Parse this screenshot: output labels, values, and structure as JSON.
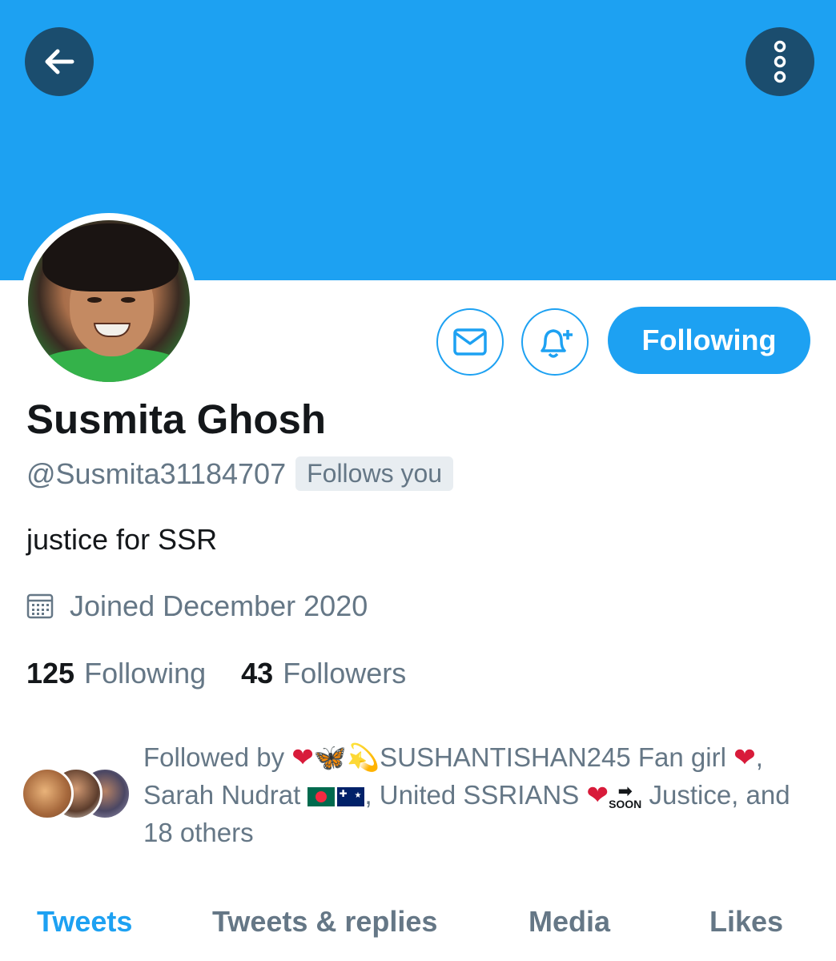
{
  "header": {
    "back_icon": "arrow-left-icon",
    "more_icon": "more-vertical-icon",
    "banner_color": "#1da1f2"
  },
  "profile": {
    "name": "Susmita Ghosh",
    "handle": "@Susmita31184707",
    "follows_you": "Follows you",
    "bio": "justice for SSR",
    "joined": "Joined December 2020",
    "following_count": "125",
    "following_label": "Following",
    "followers_count": "43",
    "followers_label": "Followers"
  },
  "actions": {
    "message_icon": "envelope-icon",
    "notify_icon": "bell-plus-icon",
    "following_button": "Following"
  },
  "followed_by": {
    "prefix": "Followed by",
    "user1": "SUSHANTISHAN245 Fan girl",
    "user2": "Sarah Nudrat",
    "user3": "United SSRIANS",
    "soon": "SOON",
    "user3_suffix": "Justice,",
    "suffix": "and 18 others"
  },
  "tabs": [
    {
      "label": "Tweets",
      "active": true
    },
    {
      "label": "Tweets & replies",
      "active": false
    },
    {
      "label": "Media",
      "active": false
    },
    {
      "label": "Likes",
      "active": false
    }
  ],
  "colors": {
    "accent": "#1da1f2",
    "secondary_text": "#657786",
    "primary_text": "#14171a"
  }
}
